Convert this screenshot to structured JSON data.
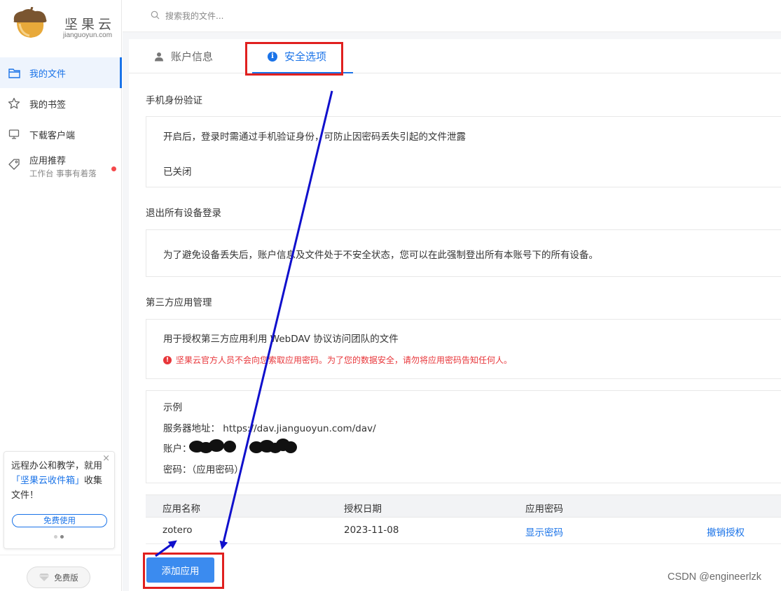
{
  "app": {
    "logo_text": "坚果云",
    "logo_sub": "jianguoyun.com"
  },
  "search": {
    "placeholder": "搜索我的文件..."
  },
  "sidebar": {
    "items": [
      {
        "label": "我的文件",
        "active": true
      },
      {
        "label": "我的书签"
      },
      {
        "label": "下载客户端"
      },
      {
        "label": "应用推荐",
        "sub": "工作台 事事有着落",
        "badge": true
      }
    ],
    "promo": {
      "text_before": "远程办公和教学，就用",
      "highlight": "「坚果云收件箱」",
      "text_after": "收集文件！",
      "button": "免费使用",
      "close": "×"
    },
    "plan_label": "免费版"
  },
  "tabs": [
    {
      "label": "账户信息",
      "icon": "user-icon"
    },
    {
      "label": "安全选项",
      "icon": "info-icon",
      "active": true
    }
  ],
  "security": {
    "phone": {
      "title": "手机身份验证",
      "desc": "开启后，登录时需通过手机验证身份，可防止因密码丢失引起的文件泄露",
      "status": "已关闭"
    },
    "logout_all": {
      "title": "退出所有设备登录",
      "desc": "为了避免设备丢失后，账户信息及文件处于不安全状态，您可以在此强制登出所有本账号下的所有设备。"
    },
    "third_party": {
      "title": "第三方应用管理",
      "desc": "用于授权第三方应用利用 WebDAV 协议访问团队的文件",
      "warning": "坚果云官方人员不会向您索取应用密码。为了您的数据安全，请勿将应用密码告知任何人。",
      "example_title": "示例",
      "server_label": "服务器地址：",
      "server_value": "https://dav.jianguoyun.com/dav/",
      "account_label": "账户：",
      "password_label": "密码：",
      "password_value": "（应用密码）",
      "table_headers": [
        "应用名称",
        "授权日期",
        "应用密码",
        ""
      ],
      "rows": [
        {
          "name": "zotero",
          "date": "2023-11-08",
          "show_pwd": "显示密码",
          "revoke": "撤销授权"
        }
      ],
      "add_button": "添加应用"
    }
  },
  "watermark": "CSDN @engineerlzk",
  "colors": {
    "accent": "#1a73e8",
    "annotation_red": "#e0201f",
    "annotation_blue": "#1010cc",
    "warning": "#e8363a"
  }
}
